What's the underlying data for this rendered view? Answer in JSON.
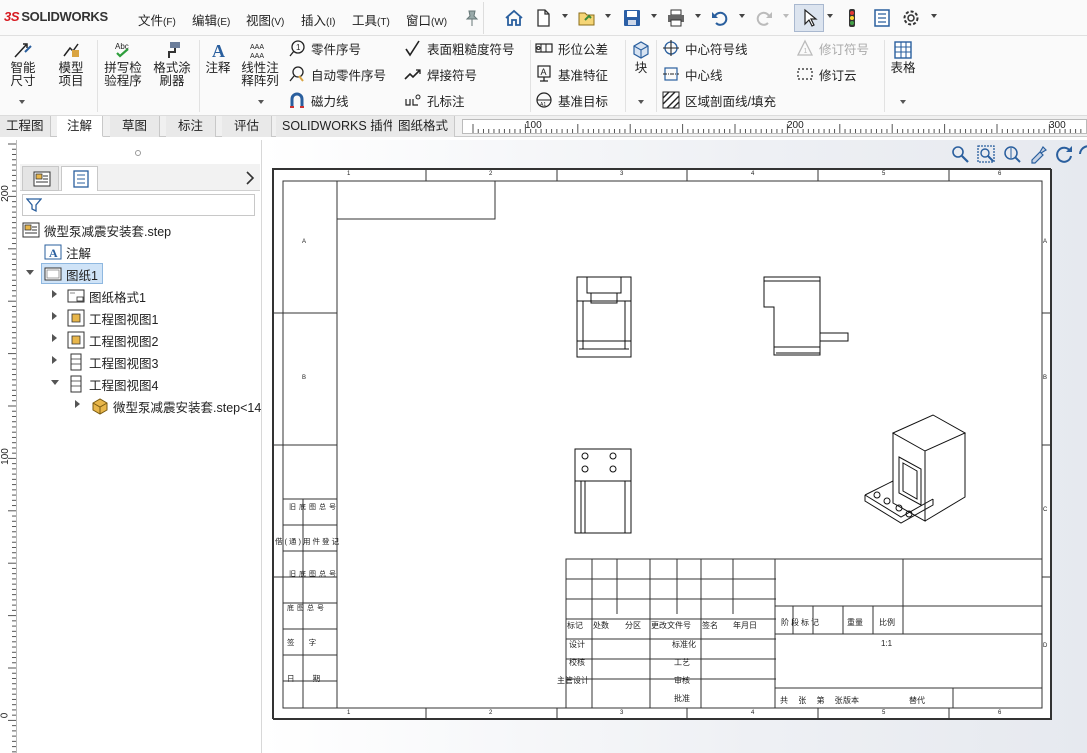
{
  "app": {
    "brand_ds": "3S",
    "brand_name": "SOLIDWORKS"
  },
  "menu": [
    {
      "label": "文件",
      "key": "(F)"
    },
    {
      "label": "编辑",
      "key": "(E)"
    },
    {
      "label": "视图",
      "key": "(V)"
    },
    {
      "label": "插入",
      "key": "(I)"
    },
    {
      "label": "工具",
      "key": "(T)"
    },
    {
      "label": "窗口",
      "key": "(W)"
    }
  ],
  "ribbon": {
    "smart_dim": "智能尺寸",
    "model_items": "模型项目",
    "spell_check": "拼写检验程序",
    "format_painter": "格式涂刷器",
    "note": "注释",
    "linear_note_pattern": "线性注释阵列",
    "balloon": "零件序号",
    "auto_balloon": "自动零件序号",
    "magnetic_line": "磁力线",
    "surface_finish": "表面粗糙度符号",
    "weld_symbol": "焊接符号",
    "hole_callout": "孔标注",
    "geometric_tolerance": "形位公差",
    "datum_feature": "基准特征",
    "datum_target": "基准目标",
    "block": "块",
    "center_mark": "中心符号线",
    "centerline": "中心线",
    "area_hatch": "区域剖面线/填充",
    "revision_symbol": "修订符号",
    "revision_cloud": "修订云",
    "table": "表格"
  },
  "tabs": [
    "工程图",
    "注解",
    "草图",
    "标注",
    "评估",
    "SOLIDWORKS 插件",
    "图纸格式"
  ],
  "active_tab": "注解",
  "ruler_h": [
    "100",
    "200",
    "300"
  ],
  "ruler_v": [
    "200",
    "100",
    "0"
  ],
  "tree": {
    "root": "微型泵减震安装套.step",
    "annotations": "注解",
    "sheet": "图纸1",
    "sheet_format": "图纸格式1",
    "view1": "工程图视图1",
    "view2": "工程图视图2",
    "view3": "工程图视图3",
    "view4": "工程图视图4",
    "part": "微型泵减震安装套.step<14"
  },
  "sheet": {
    "col_marks": [
      "1",
      "2",
      "3",
      "4",
      "5",
      "6"
    ],
    "row_marks": [
      "A",
      "B",
      "C",
      "D"
    ],
    "left_block": [
      "旧底图总号",
      "借(通)用件登记",
      "旧底图总号",
      "底图总号",
      "签 字",
      "日 期"
    ],
    "title_labels": [
      "标记",
      "处数",
      "分区",
      "更改文件号",
      "签名",
      "年月日"
    ],
    "title_rows": [
      "设计",
      "标准化",
      "校核",
      "工艺",
      "主管设计",
      "审核",
      "批准"
    ],
    "stage_labels": [
      "阶段标记",
      "重量",
      "比例"
    ],
    "scale": "1:1",
    "bottom": [
      "共 张 第 张",
      "版本",
      "替代"
    ]
  }
}
